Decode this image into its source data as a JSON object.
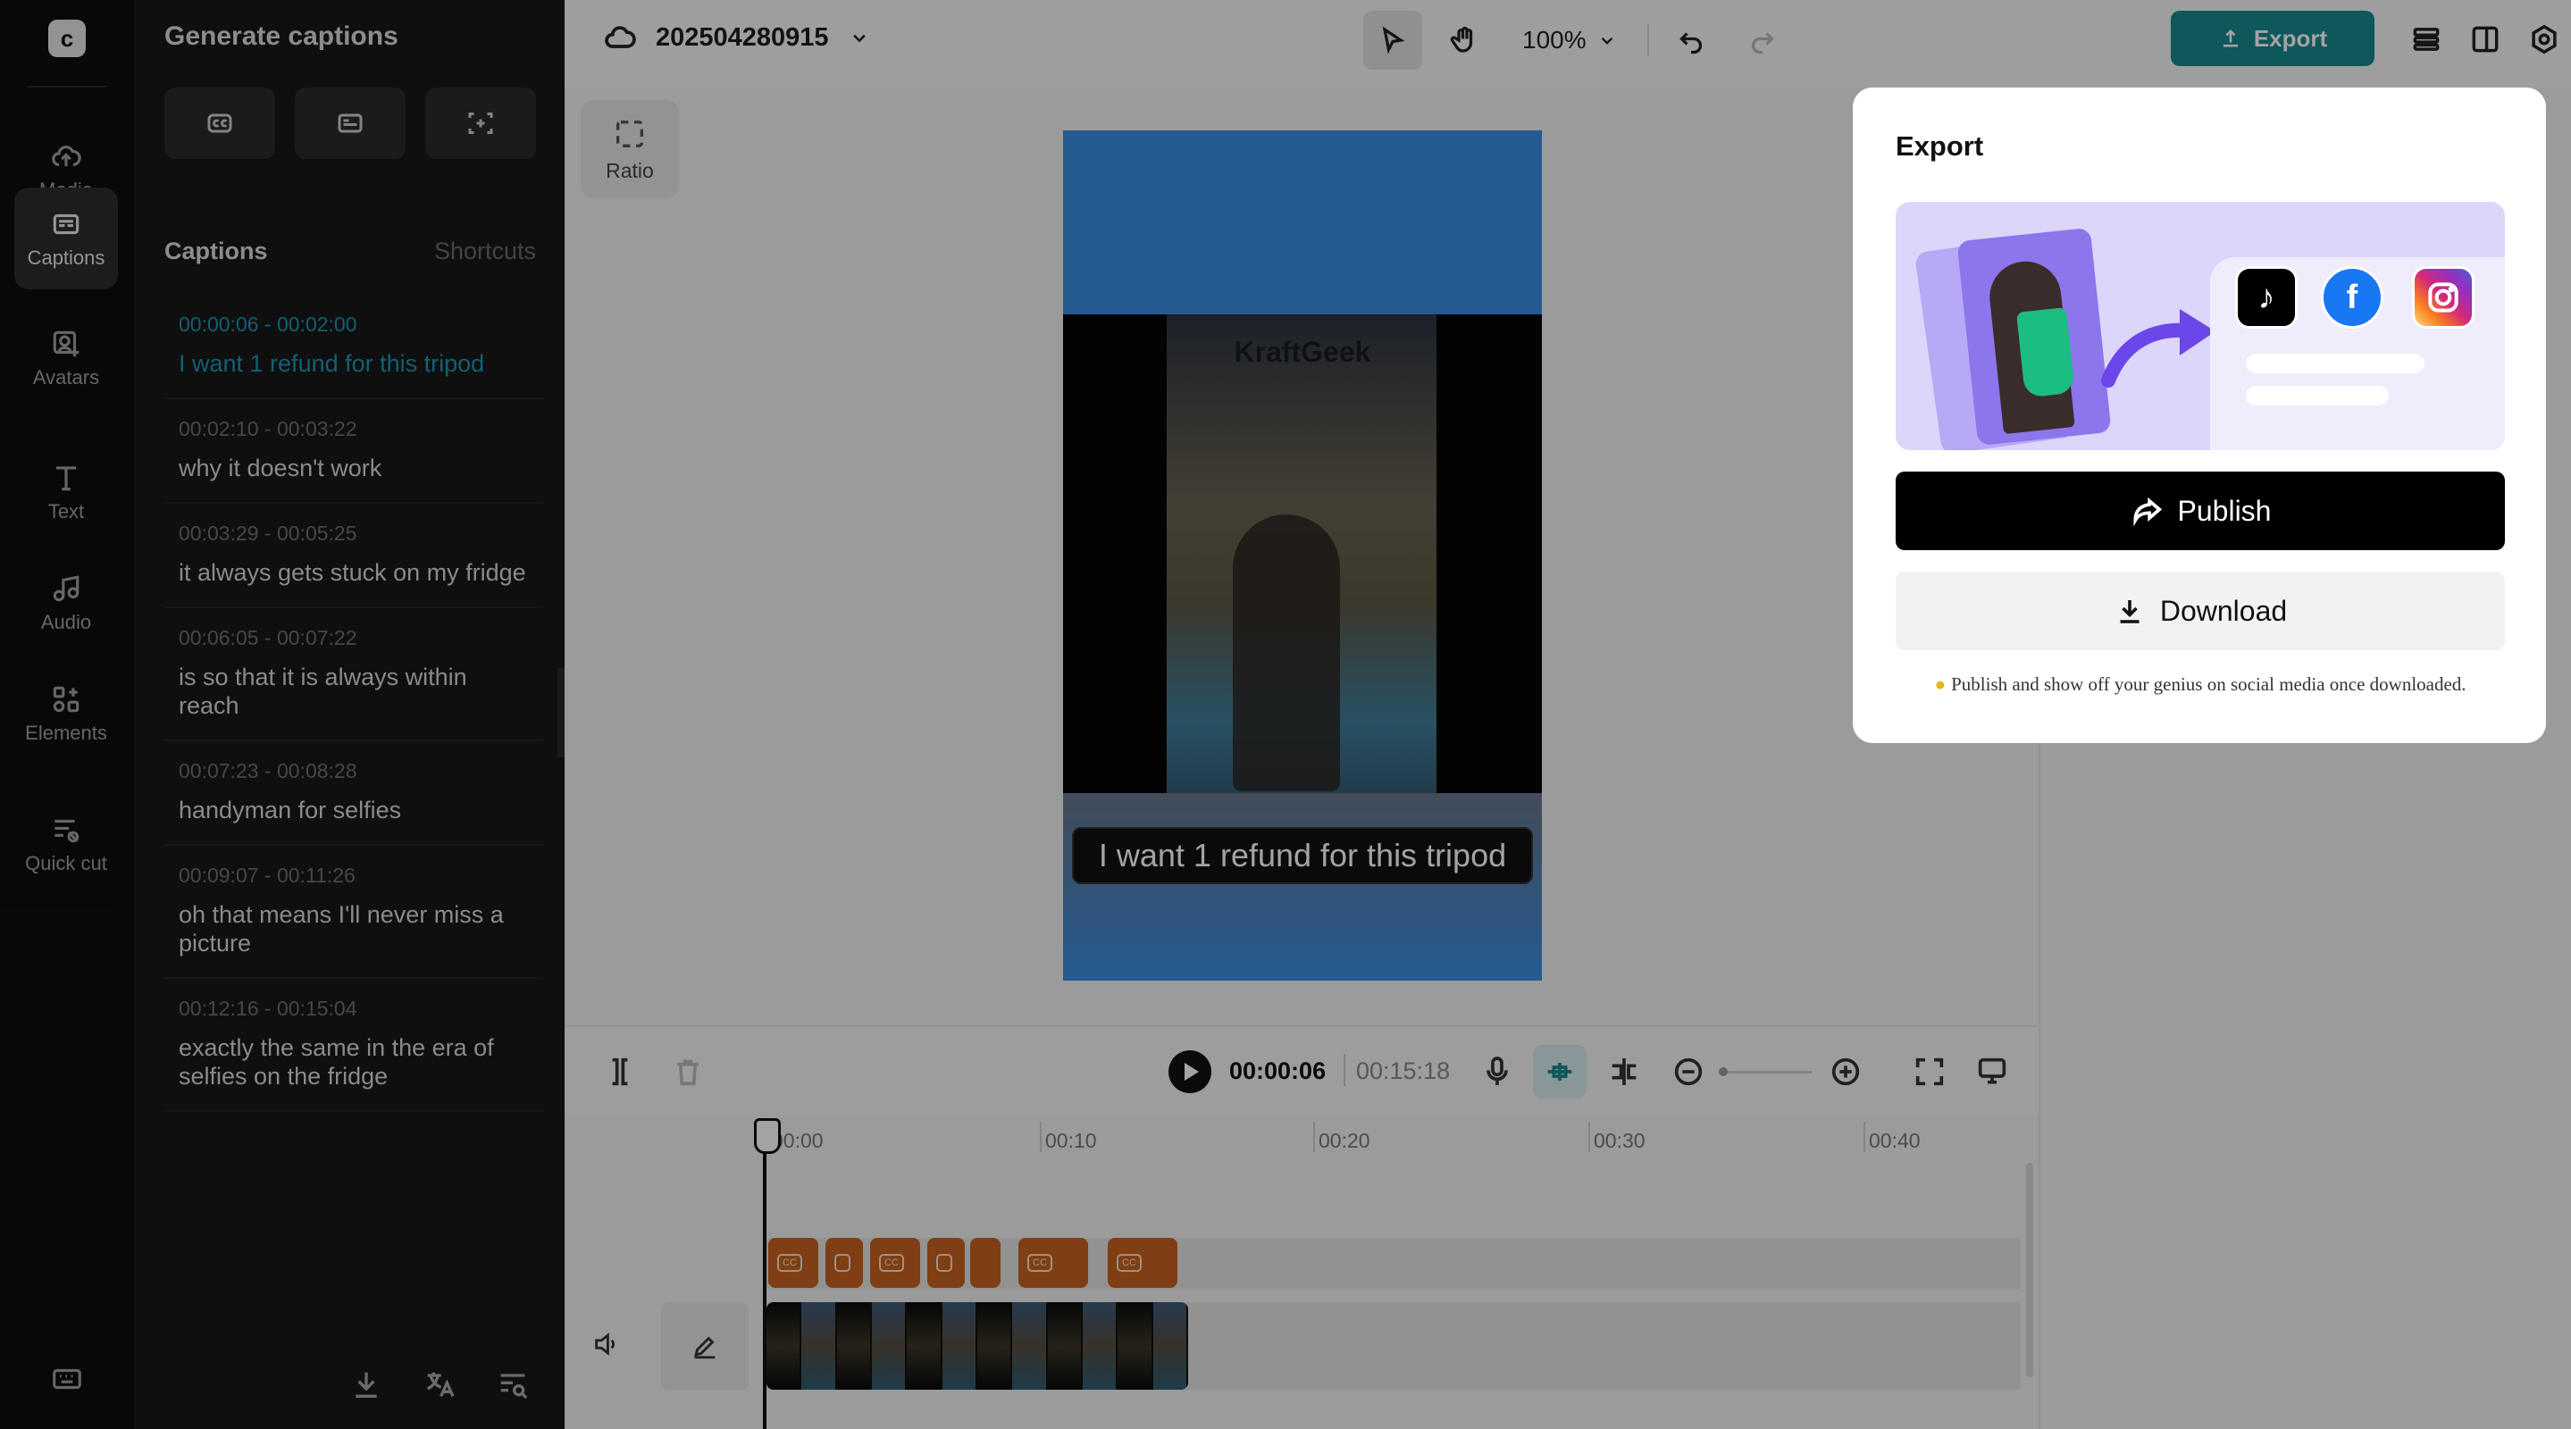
{
  "rail": {
    "items": [
      {
        "label": "Media",
        "icon": "cloud-upload-icon"
      },
      {
        "label": "Captions",
        "icon": "captions-icon"
      },
      {
        "label": "Avatars",
        "icon": "avatar-icon"
      },
      {
        "label": "Text",
        "icon": "text-icon"
      },
      {
        "label": "Audio",
        "icon": "music-note-icon"
      },
      {
        "label": "Elements",
        "icon": "elements-icon"
      },
      {
        "label": "Quick cut",
        "icon": "quick-cut-icon"
      }
    ],
    "active": "Captions"
  },
  "panel": {
    "title": "Generate captions",
    "section_title": "Captions",
    "shortcuts_label": "Shortcuts",
    "captions": [
      {
        "time": "00:00:06 - 00:02:00",
        "text": "I want 1 refund for this tripod"
      },
      {
        "time": "00:02:10 - 00:03:22",
        "text": "why it doesn't work"
      },
      {
        "time": "00:03:29 - 00:05:25",
        "text": "it always gets stuck on my fridge"
      },
      {
        "time": "00:06:05 - 00:07:22",
        "text": "is so that it is always within reach"
      },
      {
        "time": "00:07:23 - 00:08:28",
        "text": "handyman for selfies"
      },
      {
        "time": "00:09:07 - 00:11:26",
        "text": "oh that means I'll never miss a picture"
      },
      {
        "time": "00:12:16 - 00:15:04",
        "text": "exactly the same in the era of selfies on the fridge"
      }
    ]
  },
  "topbar": {
    "project_name": "202504280915",
    "zoom": "100%",
    "export_label": "Export"
  },
  "canvas": {
    "ratio_label": "Ratio",
    "brand": "KraftGeek",
    "subtitle": "I want 1 refund for this tripod"
  },
  "timeline": {
    "current_time": "00:00:06",
    "total_time": "00:15:18",
    "ruler": [
      "00:00",
      "00:10",
      "00:20",
      "00:30",
      "00:40"
    ]
  },
  "export_popup": {
    "title": "Export",
    "publish_label": "Publish",
    "download_label": "Download",
    "hint": "Publish and show off your genius on social media once downloaded."
  },
  "colors": {
    "accent_teal": "#16898f",
    "caption_active": "#1b95b4",
    "caption_chip": "#c7611f"
  }
}
